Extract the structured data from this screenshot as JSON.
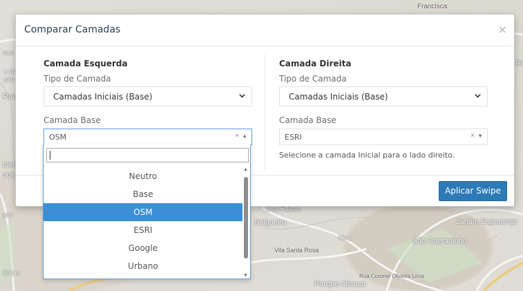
{
  "map": {
    "labels": [
      "Francisca",
      "Jardim Esperança",
      "São Caetaninho",
      "Salgueiro",
      "Vila Santa Rosa",
      "Parque Aliança",
      "Vila Falcin",
      "Rua Coronel Oliveira Lima",
      "Miná"
    ],
    "edge_labels": [
      "Rec",
      "ideb",
      "sorg",
      "Ran",
      "s Ca",
      "são",
      "nnni",
      "ano",
      "904 m"
    ]
  },
  "modal": {
    "title": "Comparar Camadas",
    "close_icon": "close-icon",
    "left": {
      "title": "Camada Esquerda",
      "type_label": "Tipo de Camada",
      "type_value": "Camadas Iniciais (Base)",
      "base_label": "Camada Base",
      "base_value": "OSM",
      "clear": "×",
      "arrow": "▲"
    },
    "right": {
      "title": "Camada Direita",
      "type_label": "Tipo de Camada",
      "type_value": "Camadas Iniciais (Base)",
      "base_label": "Camada Base",
      "base_value": "ESRI",
      "clear": "×",
      "arrow": "▼",
      "help": "Selecione a camada Inicial para o lado direito."
    },
    "apply_button": "Aplicar Swipe"
  },
  "dropdown": {
    "search_value": "",
    "options": [
      "Neutro",
      "Base",
      "OSM",
      "ESRI",
      "Google",
      "Urbano"
    ],
    "selected_index": 2
  },
  "colors": {
    "accent": "#2c7bb6",
    "selected": "#3b8fd6",
    "focus_border": "#5b9bd5"
  }
}
